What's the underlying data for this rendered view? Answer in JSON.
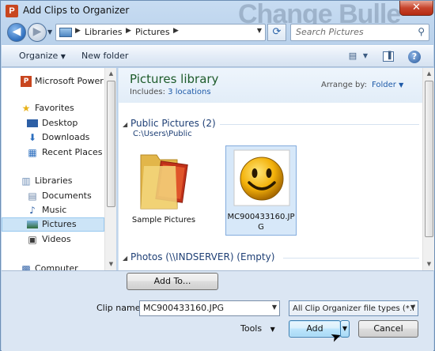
{
  "window": {
    "title": "Add Clips to Organizer",
    "app_icon_letter": "P",
    "background_watermark": "Change Bulle"
  },
  "nav": {
    "breadcrumbs": [
      "Libraries",
      "Pictures"
    ],
    "search_placeholder": "Search Pictures"
  },
  "toolbar": {
    "organize_label": "Organize",
    "new_folder_label": "New folder"
  },
  "nav_pane": {
    "items": [
      {
        "label": "Microsoft PowerPo",
        "icon": "powerpoint-icon"
      },
      {
        "label": "Favorites",
        "icon": "star-icon"
      },
      {
        "label": "Desktop",
        "icon": "desktop-icon"
      },
      {
        "label": "Downloads",
        "icon": "downloads-icon"
      },
      {
        "label": "Recent Places",
        "icon": "recent-places-icon"
      },
      {
        "label": "Libraries",
        "icon": "libraries-icon"
      },
      {
        "label": "Documents",
        "icon": "documents-icon"
      },
      {
        "label": "Music",
        "icon": "music-icon"
      },
      {
        "label": "Pictures",
        "icon": "pictures-icon",
        "selected": true
      },
      {
        "label": "Videos",
        "icon": "videos-icon"
      },
      {
        "label": "Computer",
        "icon": "computer-icon"
      }
    ]
  },
  "content": {
    "library_title": "Pictures library",
    "includes_label": "Includes:",
    "includes_link": "3 locations",
    "arrange_label": "Arrange by:",
    "arrange_value": "Folder",
    "groups": [
      {
        "header": "Public Pictures (2)",
        "path": "C:\\Users\\Public"
      },
      {
        "header": "Photos (\\\\INDSERVER) (Empty)"
      }
    ],
    "files": [
      {
        "name": "Sample Pictures",
        "icon": "folder-icon"
      },
      {
        "name_line1": "MC900433160.JP",
        "name_line2": "G",
        "icon": "smiley-icon",
        "selected": true
      }
    ]
  },
  "bottom": {
    "add_to_label": "Add To...",
    "clip_name_label": "Clip name:",
    "clip_name_value": "MC900433160.JPG",
    "file_type_value": "All Clip Organizer file types (*.f",
    "tools_label": "Tools",
    "add_label": "Add",
    "cancel_label": "Cancel"
  },
  "colors": {
    "selection": "#cce4f7",
    "library_title": "#1d5b2a",
    "link": "#1e5aa8"
  }
}
